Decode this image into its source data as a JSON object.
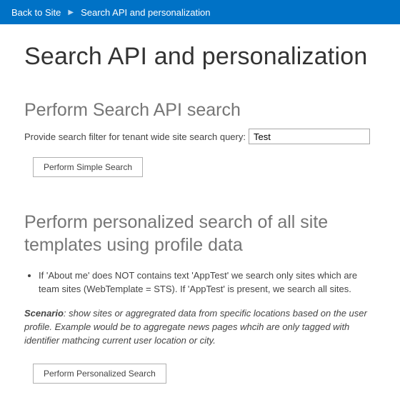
{
  "breadcrumb": {
    "back_label": "Back to Site",
    "current": "Search API and personalization"
  },
  "page": {
    "title": "Search API and personalization"
  },
  "section_simple": {
    "heading": "Perform Search API search",
    "filter_label": "Provide search filter for tenant wide site search query:",
    "filter_value": "Test",
    "button_label": "Perform Simple Search"
  },
  "section_personalized": {
    "heading": "Perform personalized search of all site templates using profile data",
    "bullet1": "If 'About me' does NOT contains text 'AppTest' we search only sites which are team sites (WebTemplate = STS). If 'AppTest' is present, we search all sites.",
    "scenario_prefix": "Scenario",
    "scenario_rest": ": show sites or aggregrated data from specific locations based on the user profile. Example would be to aggregate news pages whcih are only tagged with identifier mathcing current user location or city.",
    "button_label": "Perform Personalized Search"
  }
}
